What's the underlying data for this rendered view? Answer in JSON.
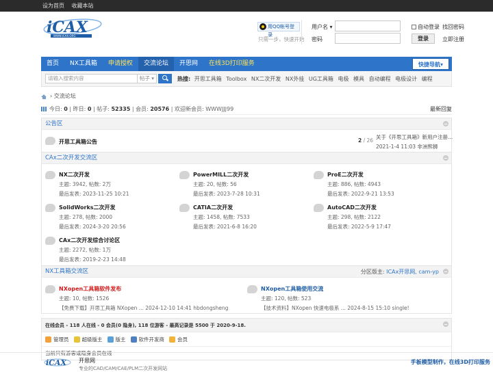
{
  "topbar": {
    "set_home": "设为首页",
    "bookmark": "收藏本站"
  },
  "login": {
    "qq_button": "用QQ帐号登录",
    "qq_tip": "只需一步，快速开始",
    "username_label": "用户名",
    "password_label": "密码",
    "auto_login": "自动登录",
    "forgot_password": "找回密码",
    "login_button": "登录",
    "register": "立即注册"
  },
  "nav": {
    "items": [
      "首页",
      "NX工具箱",
      "申请授权",
      "交流论坛",
      "开思网",
      "在线3D打印服务"
    ],
    "quick": "快捷导航"
  },
  "search": {
    "placeholder": "请输入搜索内容",
    "type": "帖子",
    "hot_label": "热搜:",
    "hot": [
      "开思工具箱",
      "Toolbox",
      "NX二次开发",
      "NX外挂",
      "UG工具箱",
      "电极",
      "模具",
      "自动编程",
      "电极设计",
      "编程"
    ]
  },
  "breadcrumb": {
    "current": "交流论坛"
  },
  "stats": {
    "today_label": "今日:",
    "today": "0",
    "yesterday_label": "昨日:",
    "yesterday": "0",
    "posts_label": "帖子:",
    "posts": "52335",
    "members_label": "会员:",
    "members": "20576",
    "welcome": "欢迎新会员:",
    "newest_member": "WWWJJJ99",
    "latest_reply": "最新回复"
  },
  "announce": {
    "title": "公告区",
    "forum": "开思工具箱公告",
    "count_current": "2",
    "count_total": "/ 26",
    "last_title": "关于《开思工具箱》新用户注册...",
    "last_time": "2021-1-4 11:03 非洲熊狮"
  },
  "cax": {
    "title": "CAx二次开发交流区",
    "forums": [
      {
        "name": "NX二次开发",
        "stats": "主题: 3942, 帖数: 2万",
        "last": "最后发表: 2023-11-25 10:21"
      },
      {
        "name": "PowerMILL二次开发",
        "stats": "主题: 20, 帖数: 56",
        "last": "最后发表: 2023-7-28 10:31"
      },
      {
        "name": "ProE二次开发",
        "stats": "主题: 886, 帖数: 4943",
        "last": "最后发表: 2022-9-21 13:53"
      },
      {
        "name": "SolidWorks二次开发",
        "stats": "主题: 278, 帖数: 2000",
        "last": "最后发表: 2024-3-20 20:56"
      },
      {
        "name": "CATIA二次开发",
        "stats": "主题: 1458, 帖数: 7533",
        "last": "最后发表: 2021-6-8 16:20"
      },
      {
        "name": "AutoCAD二次开发",
        "stats": "主题: 298, 帖数: 2122",
        "last": "最后发表: 2022-5-9 17:47"
      },
      {
        "name": "CAx二次开发综合讨论区",
        "stats": "主题: 2272, 帖数: 1万",
        "last": "最后发表: 2019-2-23 14:48"
      }
    ]
  },
  "nxtool": {
    "title": "NX工具箱交流区",
    "moderator_label": "分区版主:",
    "moderators": "ICAx开思网, cam-yp",
    "forums": [
      {
        "name": "NXopen工具箱软件发布",
        "stats": "主题: 10, 帖数: 1526",
        "last": "【免费下载】开思工具箱 NXopen ... 2024-12-10 14:41 hbdongsheng"
      },
      {
        "name": "NXopen工具箱使用交流",
        "stats": "主题: 120, 帖数: 523",
        "last": "【技术资料】NXopen 快速电极系 ... 2024-8-15 15:10 single!"
      }
    ]
  },
  "online": {
    "header": "在线会员 - 118 人在线 - 0 会员(0 隐身), 118 位游客 - 最高记录是 5500 于 2020-9-18.",
    "legend": [
      "管理员",
      "超级版主",
      "版主",
      "软件开发商",
      "会员"
    ],
    "legend_colors": [
      "#f2a23a",
      "#e8c43b",
      "#5ba0d8",
      "#4f7fc0",
      "#f0b43c"
    ],
    "note": "当前只有游客或隐身会员在线"
  },
  "footer": {
    "name": "开思网",
    "sub": "专业的CAD/CAM/CAE/PLM二次开发网站",
    "right": "手板模型制作，在线3D打印服务"
  }
}
